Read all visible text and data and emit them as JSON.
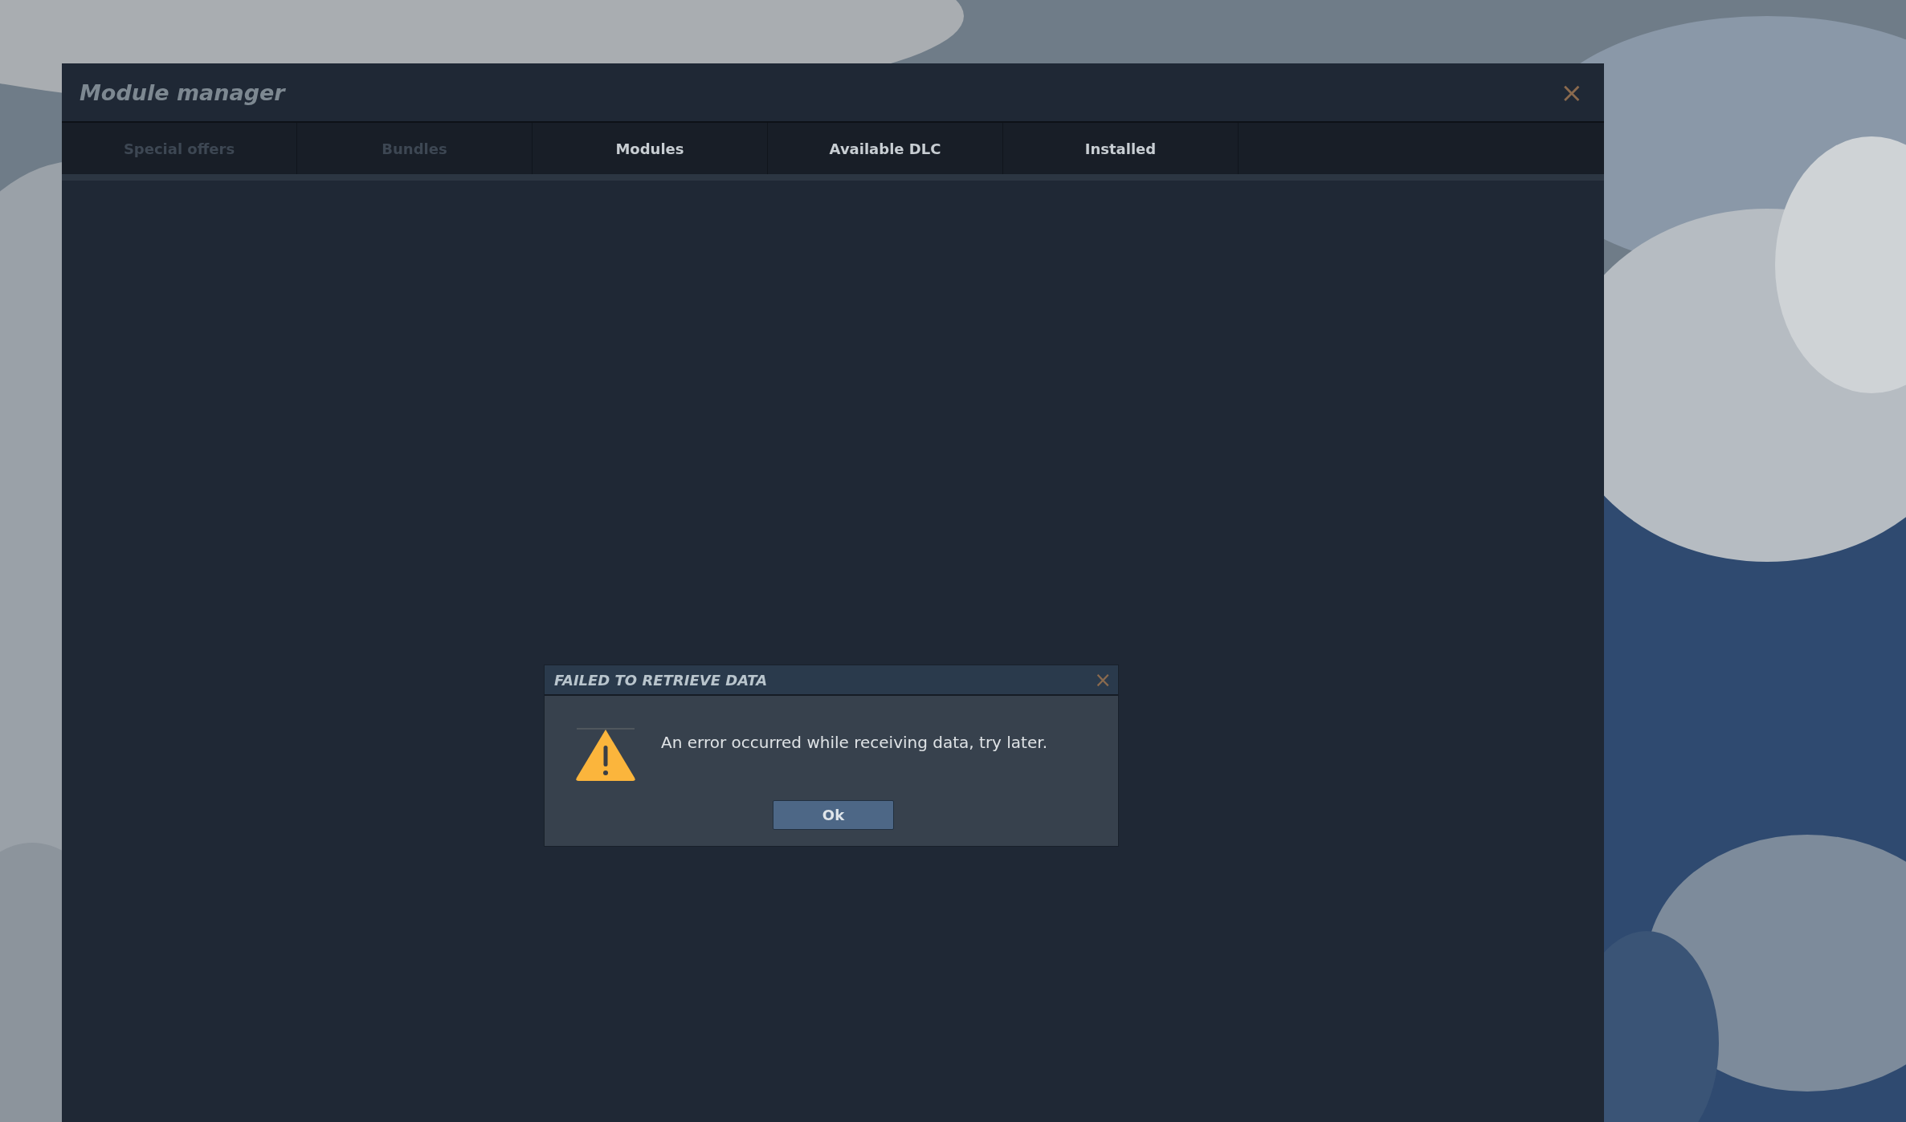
{
  "window": {
    "title": "Module manager",
    "close": "×"
  },
  "tabs": [
    {
      "label": "Special offers",
      "disabled": true
    },
    {
      "label": "Bundles",
      "disabled": true
    },
    {
      "label": "Modules",
      "disabled": false
    },
    {
      "label": "Available DLC",
      "disabled": false
    },
    {
      "label": "Installed",
      "disabled": false
    }
  ],
  "dialog": {
    "title": "FAILED TO RETRIEVE DATA",
    "close": "×",
    "message": "An error occurred while receiving data, try later.",
    "buttons": [
      "Ok"
    ]
  }
}
